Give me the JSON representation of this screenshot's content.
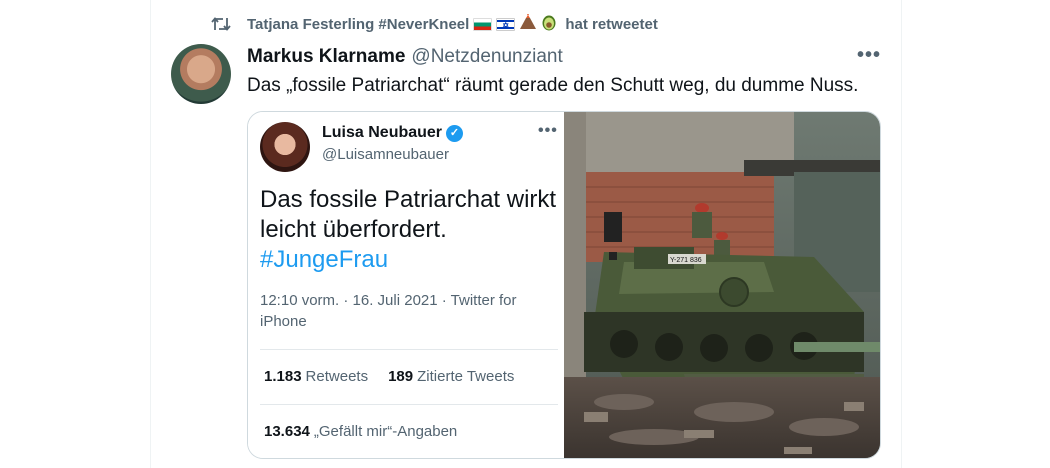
{
  "retweet": {
    "icon": "retweet-icon",
    "user": "Tatjana Festerling #NeverKneel",
    "emoji_names": [
      "flag-bulgaria",
      "flag-israel",
      "volcano",
      "avocado"
    ],
    "suffix": "hat retweetet"
  },
  "tweet": {
    "author_name": "Markus Klarname",
    "author_handle": "@Netzdenunziant",
    "more_icon": "more-dots-icon",
    "text": "Das „fossile Patriarchat“ räumt gerade den Schutt weg, du dumme Nuss."
  },
  "embedded_screenshot": {
    "name": "Luisa Neubauer",
    "verified_icon": "verified-badge-icon",
    "handle": "@Luisamneubauer",
    "text_line1": "Das fossile Patriarchat wirkt",
    "text_line2": "leicht überfordert.",
    "hashtag": "#JungeFrau",
    "meta": "12:10 vorm. · 16. Juli 2021 · Twitter for iPhone",
    "retweets_count": "1.183",
    "retweets_label": "Retweets",
    "quotes_count": "189",
    "quotes_label": "Zitierte Tweets",
    "likes_count": "13.634",
    "likes_label": "„Gefällt mir“-Angaben"
  },
  "photo": {
    "description_icon": "tank-photo",
    "plate": "Y-271 836"
  },
  "colors": {
    "accent": "#1d9bf0",
    "secondary_text": "#536471",
    "border": "#cfd9de"
  }
}
